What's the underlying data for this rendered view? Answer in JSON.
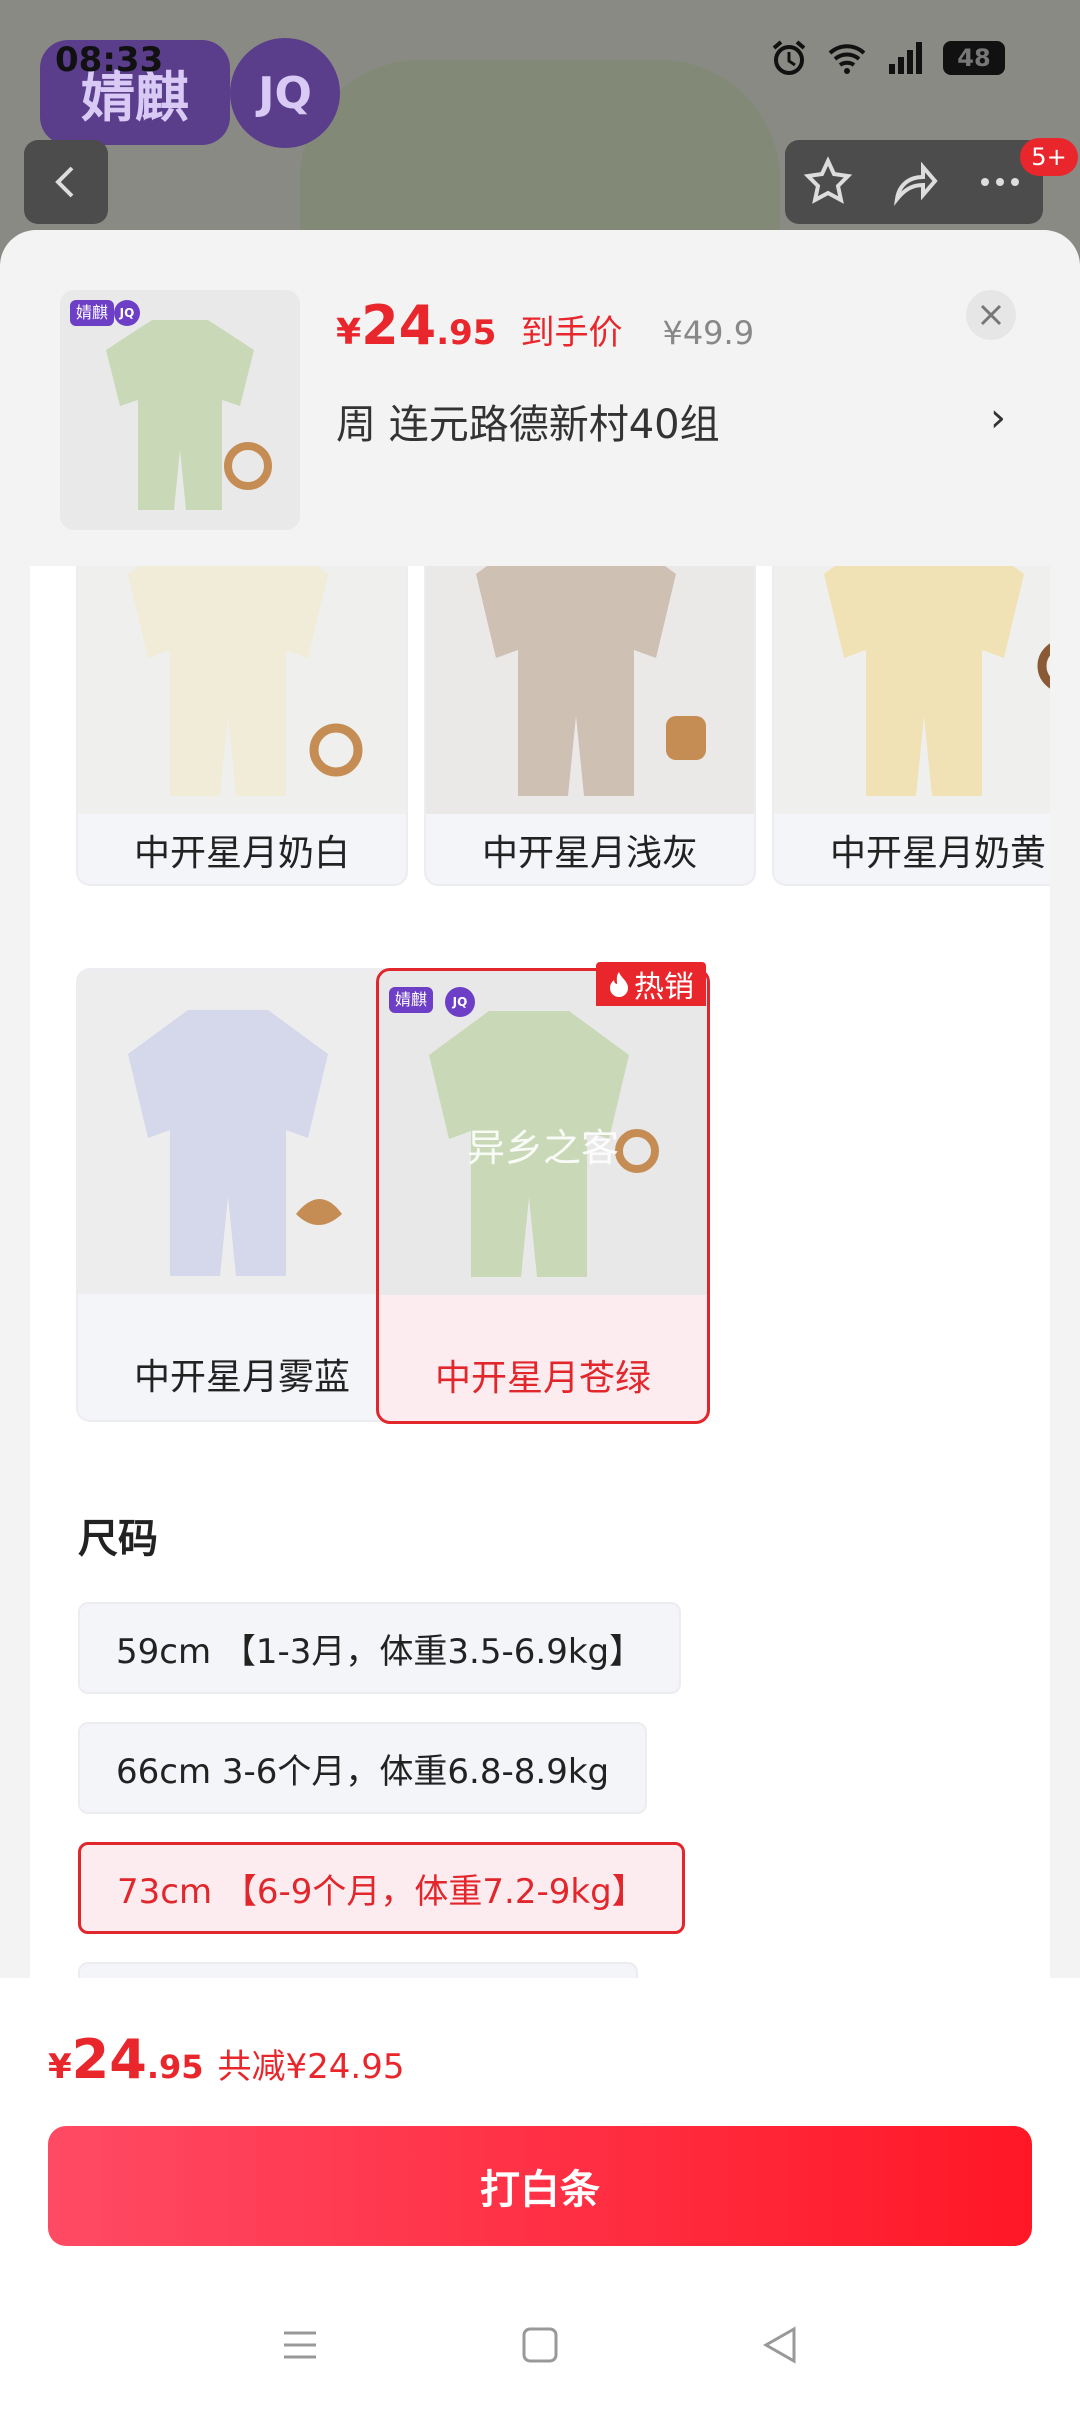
{
  "status": {
    "time": "08:33",
    "battery": "48",
    "network": "4G"
  },
  "brand": {
    "name": "婧麒",
    "short": "JQ"
  },
  "header_badge": "5+",
  "summary": {
    "price_symbol": "¥",
    "price_int": "24",
    "price_dec": ".95",
    "price_label": "到手价",
    "original_price": "¥49.9",
    "address": "周  连元路德新村40组"
  },
  "colors": [
    {
      "label": "中开星月奶白",
      "tone": "#f1ecd8"
    },
    {
      "label": "中开星月浅灰",
      "tone": "#cfc0b4"
    },
    {
      "label": "中开星月奶黄",
      "tone": "#f1e2b5"
    },
    {
      "label": "中开星月雾蓝",
      "tone": "#d5d7ea"
    },
    {
      "label": "中开星月苍绿",
      "tone": "#c9d8b6",
      "selected": true,
      "tag": "热销",
      "watermark": "异乡之客"
    }
  ],
  "sizes": {
    "title": "尺码",
    "options": [
      "59cm 【1-3月，体重3.5-6.9kg】",
      "66cm 3-6个月，体重6.8-8.9kg",
      "73cm 【6-9个月，体重7.2-9kg】"
    ],
    "selected_index": 2
  },
  "footer": {
    "price_symbol": "¥",
    "price_int": "24",
    "price_dec": ".95",
    "savings": "共减¥24.95",
    "cta_label": "打白条"
  },
  "accent": "#e9262c"
}
